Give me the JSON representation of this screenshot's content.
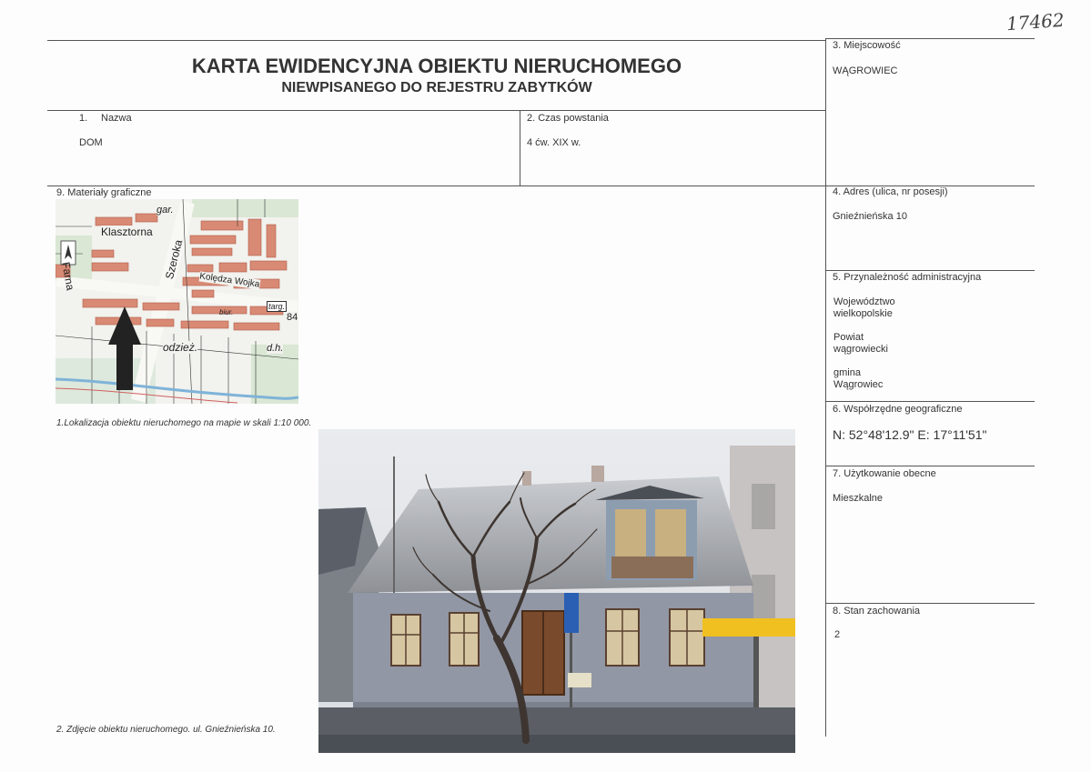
{
  "page_number": "17462",
  "title_main": "KARTA EWIDENCYJNA OBIEKTU NIERUCHOMEGO",
  "title_sub": "NIEWPISANEGO DO REJESTRU ZABYTKÓW",
  "fields": {
    "name_number": "1.",
    "name_label": "Nazwa",
    "name_value": "DOM",
    "time_label": "2. Czas powstania",
    "time_value": "4 ćw.  XIX w.",
    "place_label": "3. Miejscowość",
    "place_value": "WĄGROWIEC",
    "address_label": "4. Adres (ulica, nr posesji)",
    "address_value": "Gnieźnieńska 10",
    "admin_label": "5. Przynależność administracyjna",
    "admin_voivodeship_label": "Województwo",
    "admin_voivodeship_value": "wielkopolskie",
    "admin_county_label": "Powiat",
    "admin_county_value": "wągrowiecki",
    "admin_commune_label": "gmina",
    "admin_commune_value": "Wągrowiec",
    "coords_label": "6. Współrzędne geograficzne",
    "coords_value": "N: 52°48'12.9\"  E: 17°11'51\"",
    "usage_label": "7. Użytkowanie obecne",
    "usage_value": "Mieszkalne",
    "condition_label": "8. Stan zachowania",
    "condition_value": "2",
    "graphics_label": "9. Materiały graficzne"
  },
  "map": {
    "labels": [
      "gar.",
      "Klasztorna",
      "Farna",
      "Szeroka",
      "Kolędza Wojka",
      "targ.",
      "84",
      "biur.",
      "odzież.",
      "d.h."
    ]
  },
  "captions": {
    "map_caption": "1.Lokalizacja obiektu nieruchomego na mapie w skali 1:10 000.",
    "photo_caption": "2. Zdjęcie obiektu nieruchomego. ul. Gnieźnieńska 10."
  }
}
